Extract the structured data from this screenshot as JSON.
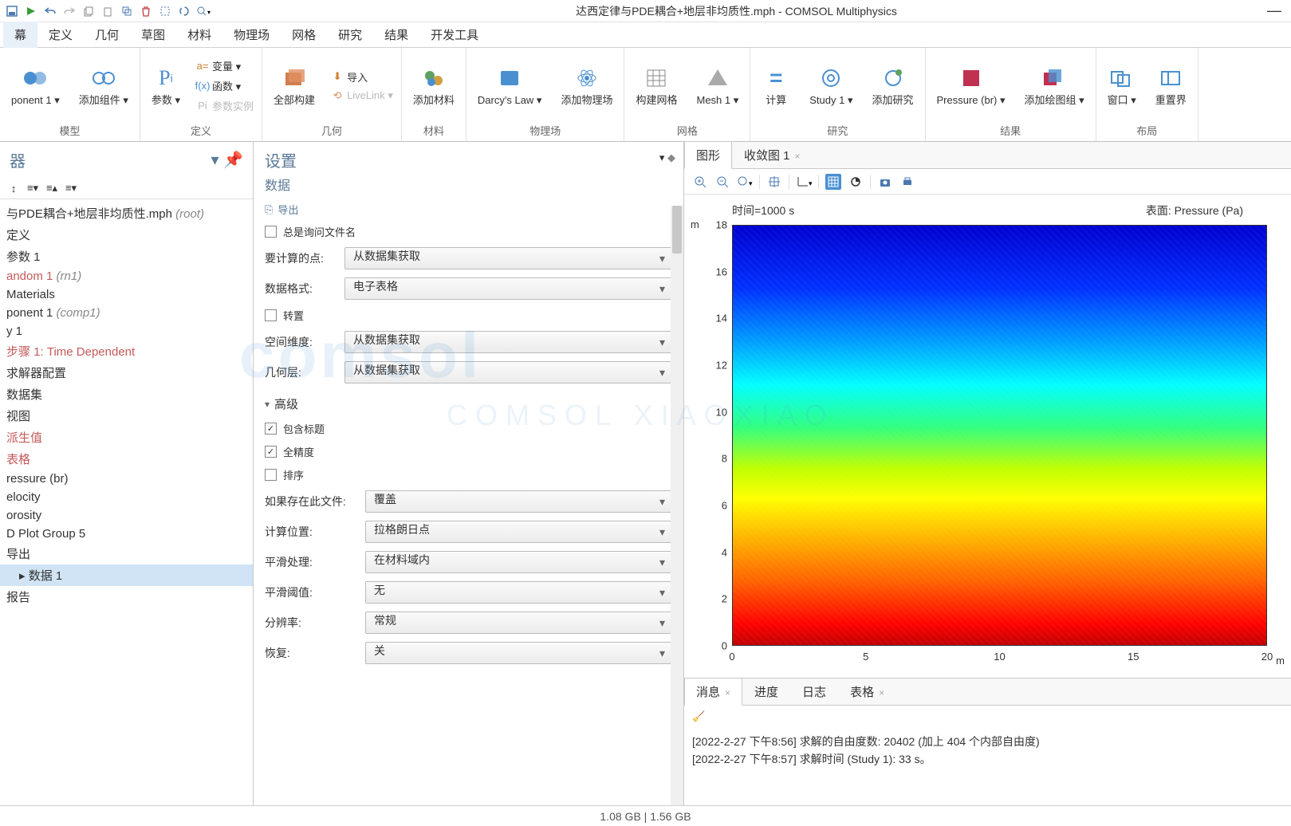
{
  "window": {
    "title": "达西定律与PDE耦合+地层非均质性.mph - COMSOL Multiphysics"
  },
  "menubar": [
    "幕",
    "定义",
    "几何",
    "草图",
    "材料",
    "物理场",
    "网格",
    "研究",
    "结果",
    "开发工具"
  ],
  "ribbon": {
    "groups": [
      {
        "label": "模型",
        "items": [
          {
            "label": "ponent 1 ▾",
            "name": "component-button"
          },
          {
            "label": "添加组件 ▾",
            "name": "add-component-button"
          }
        ]
      },
      {
        "label": "定义",
        "items": [
          {
            "label": "参数 ▾",
            "name": "parameters-button"
          }
        ],
        "small": [
          {
            "label": "变量 ▾",
            "name": "variables-item"
          },
          {
            "label": "函数 ▾",
            "name": "functions-item"
          },
          {
            "label": "参数实例",
            "name": "param-case-item",
            "muted": true
          }
        ]
      },
      {
        "label": "几何",
        "items": [
          {
            "label": "全部构建",
            "name": "build-all-button"
          }
        ],
        "small": [
          {
            "label": "导入",
            "name": "import-item"
          },
          {
            "label": "LiveLink ▾",
            "name": "livelink-item",
            "muted": true
          }
        ]
      },
      {
        "label": "材料",
        "items": [
          {
            "label": "添加材料",
            "name": "add-material-button"
          }
        ]
      },
      {
        "label": "物理场",
        "items": [
          {
            "label": "Darcy's Law ▾",
            "name": "darcy-law-button"
          },
          {
            "label": "添加物理场",
            "name": "add-physics-button"
          }
        ]
      },
      {
        "label": "网格",
        "items": [
          {
            "label": "构建网格",
            "name": "build-mesh-button"
          },
          {
            "label": "Mesh 1 ▾",
            "name": "mesh-1-button"
          }
        ]
      },
      {
        "label": "研究",
        "items": [
          {
            "label": "计算",
            "name": "compute-button"
          },
          {
            "label": "Study 1 ▾",
            "name": "study-1-button"
          },
          {
            "label": "添加研究",
            "name": "add-study-button"
          }
        ]
      },
      {
        "label": "结果",
        "items": [
          {
            "label": "Pressure (br) ▾",
            "name": "pressure-button"
          },
          {
            "label": "添加绘图组 ▾",
            "name": "add-plot-group-button"
          }
        ]
      },
      {
        "label": "布局",
        "items": [
          {
            "label": "窗口 ▾",
            "name": "windows-button"
          },
          {
            "label": "重置界",
            "name": "reset-layout-button"
          }
        ]
      }
    ]
  },
  "treePanel": {
    "title": "器",
    "items": [
      {
        "label": "与PDE耦合+地层非均质性.mph",
        "tag": "(root)"
      },
      {
        "label": "定义"
      },
      {
        "label": "参数 1"
      },
      {
        "label": "andom 1",
        "tag": "(rn1)",
        "red": true
      },
      {
        "label": "Materials"
      },
      {
        "label": "ponent 1",
        "tag": "(comp1)"
      },
      {
        "label": "y 1"
      },
      {
        "label": "步骤 1: Time Dependent",
        "red": true
      },
      {
        "label": "求解器配置"
      },
      {
        "label": "数据集"
      },
      {
        "label": "视图"
      },
      {
        "label": "派生值",
        "red": true
      },
      {
        "label": "表格",
        "red": true
      },
      {
        "label": "ressure (br)"
      },
      {
        "label": "elocity"
      },
      {
        "label": "orosity"
      },
      {
        "label": "D Plot Group 5"
      },
      {
        "label": "导出"
      },
      {
        "label": "数据 1",
        "selected": true,
        "indent": true
      },
      {
        "label": "报告"
      }
    ]
  },
  "settings": {
    "title": "设置",
    "subtitle": "数据",
    "exportLink": "导出",
    "fields": {
      "alwaysAskFile": {
        "label": "总是询问文件名",
        "checked": false
      },
      "pointsToCompute": {
        "label": "要计算的点:",
        "value": "从数据集获取"
      },
      "dataFormat": {
        "label": "数据格式:",
        "value": "电子表格"
      },
      "transpose": {
        "label": "转置",
        "checked": false
      },
      "spaceDim": {
        "label": "空间维度:",
        "value": "从数据集获取"
      },
      "geomLevel": {
        "label": "几何层:",
        "value": "从数据集获取"
      }
    },
    "advancedHead": "高级",
    "adv": {
      "includeHeader": {
        "label": "包含标题",
        "checked": true
      },
      "fullPrecision": {
        "label": "全精度",
        "checked": true
      },
      "sort": {
        "label": "排序",
        "checked": false
      },
      "ifExists": {
        "label": "如果存在此文件:",
        "value": "覆盖"
      },
      "evalPos": {
        "label": "计算位置:",
        "value": "拉格朗日点"
      },
      "smoothing": {
        "label": "平滑处理:",
        "value": "在材料域内"
      },
      "smoothThresh": {
        "label": "平滑阈值:",
        "value": "无"
      },
      "resolution": {
        "label": "分辨率:",
        "value": "常规"
      },
      "recover": {
        "label": "恢复:",
        "value": "关"
      }
    }
  },
  "graphics": {
    "tabs": [
      {
        "label": "图形",
        "active": true
      },
      {
        "label": "收敛图 1",
        "closable": true
      }
    ],
    "plot": {
      "timeLabel": "时间=1000 s",
      "surfaceLabel": "表面: Pressure (Pa)",
      "yTicks": [
        "18",
        "16",
        "14",
        "12",
        "10",
        "8",
        "6",
        "4",
        "2",
        "0"
      ],
      "xTicks": [
        "0",
        "5",
        "10",
        "15",
        "20"
      ],
      "unitY": "m",
      "unitX": "m"
    }
  },
  "bottom": {
    "tabs": [
      {
        "label": "消息",
        "closable": true,
        "active": true
      },
      {
        "label": "进度"
      },
      {
        "label": "日志"
      },
      {
        "label": "表格",
        "closable": true
      }
    ],
    "log": [
      "[2022-2-27 下午8:56] 求解的自由度数: 20402 (加上 404 个内部自由度)",
      "[2022-2-27 下午8:57] 求解时间 (Study 1): 33 s。"
    ]
  },
  "statusbar": {
    "mem": "1.08 GB | 1.56 GB"
  },
  "chart_data": {
    "type": "heatmap",
    "title": "Pressure (Pa)",
    "time": "时间=1000 s",
    "xlabel": "m",
    "ylabel": "m",
    "xlim": [
      0,
      20
    ],
    "ylim": [
      0,
      18
    ],
    "xticks": [
      0,
      5,
      10,
      15,
      20
    ],
    "yticks": [
      0,
      2,
      4,
      6,
      8,
      10,
      12,
      14,
      16,
      18
    ],
    "note": "2D surface plot, colormap rainbow (blue=low at top, red=high at bottom), pressure field from Darcy's Law simulation"
  }
}
